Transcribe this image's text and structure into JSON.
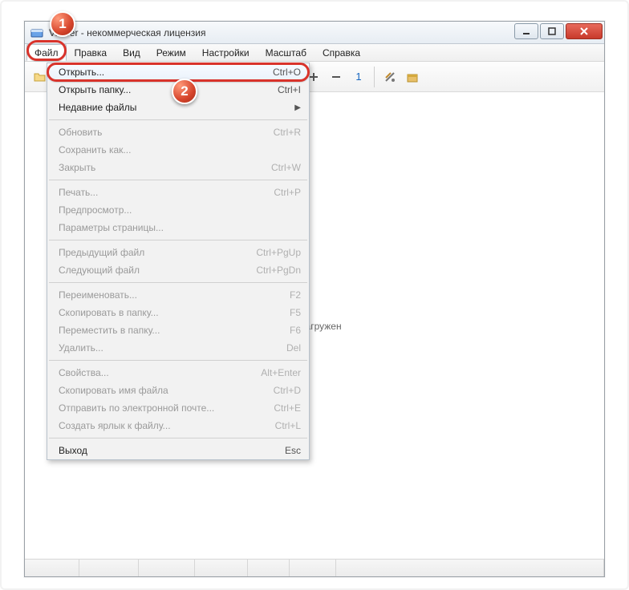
{
  "window": {
    "title_suffix": "Viewer - некоммерческая лицензия"
  },
  "menubar": [
    "Файл",
    "Правка",
    "Вид",
    "Режим",
    "Настройки",
    "Масштаб",
    "Справка"
  ],
  "dropdown": {
    "groups": [
      [
        {
          "label": "Открыть...",
          "shortcut": "Ctrl+O",
          "enabled": true,
          "highlight": true
        },
        {
          "label": "Открыть папку...",
          "shortcut": "Ctrl+I",
          "enabled": true
        },
        {
          "label": "Недавние файлы",
          "shortcut": "",
          "enabled": true,
          "submenu": true
        }
      ],
      [
        {
          "label": "Обновить",
          "shortcut": "Ctrl+R",
          "enabled": false
        },
        {
          "label": "Сохранить как...",
          "shortcut": "",
          "enabled": false
        },
        {
          "label": "Закрыть",
          "shortcut": "Ctrl+W",
          "enabled": false
        }
      ],
      [
        {
          "label": "Печать...",
          "shortcut": "Ctrl+P",
          "enabled": false
        },
        {
          "label": "Предпросмотр...",
          "shortcut": "",
          "enabled": false
        },
        {
          "label": "Параметры страницы...",
          "shortcut": "",
          "enabled": false
        }
      ],
      [
        {
          "label": "Предыдущий файл",
          "shortcut": "Ctrl+PgUp",
          "enabled": false
        },
        {
          "label": "Следующий файл",
          "shortcut": "Ctrl+PgDn",
          "enabled": false
        }
      ],
      [
        {
          "label": "Переименовать...",
          "shortcut": "F2",
          "enabled": false
        },
        {
          "label": "Скопировать в папку...",
          "shortcut": "F5",
          "enabled": false
        },
        {
          "label": "Переместить в папку...",
          "shortcut": "F6",
          "enabled": false
        },
        {
          "label": "Удалить...",
          "shortcut": "Del",
          "enabled": false
        }
      ],
      [
        {
          "label": "Свойства...",
          "shortcut": "Alt+Enter",
          "enabled": false
        },
        {
          "label": "Скопировать имя файла",
          "shortcut": "Ctrl+D",
          "enabled": false
        },
        {
          "label": "Отправить по электронной почте...",
          "shortcut": "Ctrl+E",
          "enabled": false
        },
        {
          "label": "Создать ярлык к файлу...",
          "shortcut": "Ctrl+L",
          "enabled": false
        }
      ],
      [
        {
          "label": "Выход",
          "shortcut": "Esc",
          "enabled": true
        }
      ]
    ]
  },
  "content": {
    "status_text": "не загружен"
  },
  "toolbar": {
    "one_label": "1"
  },
  "annotations": {
    "badge1": "1",
    "badge2": "2"
  }
}
